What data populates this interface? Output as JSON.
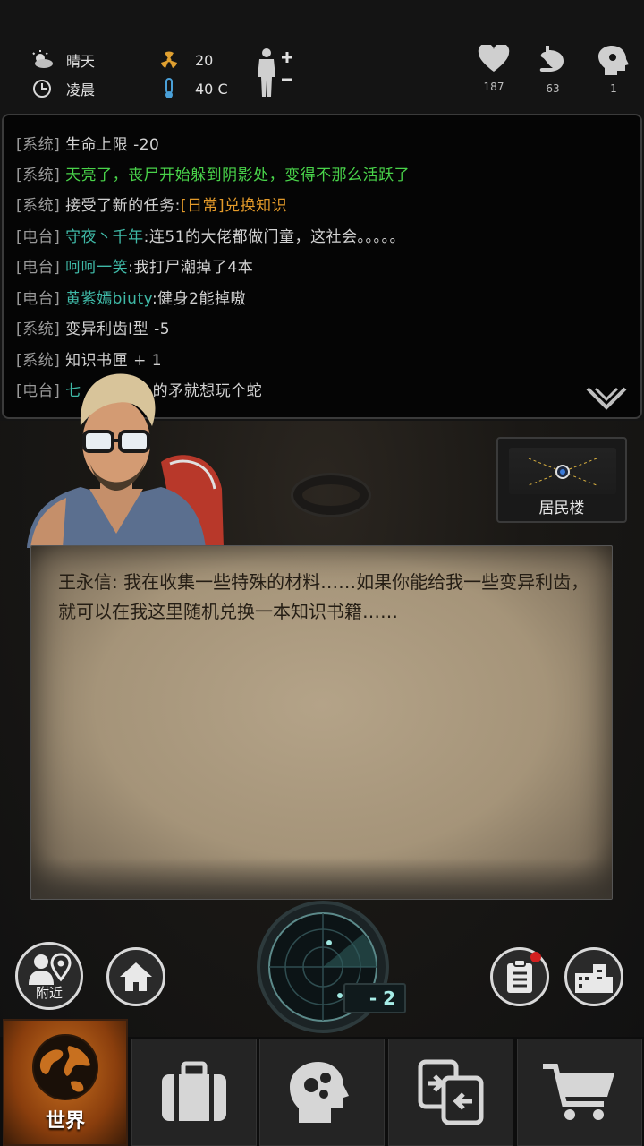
{
  "status": {
    "weather": "晴天",
    "time_of_day": "凌晨",
    "radiation": "20",
    "temperature": "40 C",
    "vitals": [
      {
        "name": "health",
        "icon": "heart-icon",
        "value": "187"
      },
      {
        "name": "hunger",
        "icon": "stomach-icon",
        "value": "63"
      },
      {
        "name": "mind",
        "icon": "head-icon",
        "value": "1"
      }
    ]
  },
  "log": [
    {
      "tag": "[系统]",
      "parts": [
        {
          "text": "生命上限 -20",
          "color": "default"
        }
      ]
    },
    {
      "tag": "[系统]",
      "parts": [
        {
          "text": "天亮了，丧尸开始躲到阴影处，变得不那么活跃了",
          "color": "green"
        }
      ]
    },
    {
      "tag": "[系统]",
      "parts": [
        {
          "text": "接受了新的任务:",
          "color": "default"
        },
        {
          "text": "[日常]兑换知识",
          "color": "orange"
        }
      ]
    },
    {
      "tag": "[电台]",
      "parts": [
        {
          "text": "守夜丶千年",
          "color": "teal"
        },
        {
          "text": ":连51的大佬都做门童，这社会。。。。。",
          "color": "default"
        }
      ]
    },
    {
      "tag": "[电台]",
      "parts": [
        {
          "text": "呵呵一笑",
          "color": "teal"
        },
        {
          "text": ":我打尸潮掉了4本",
          "color": "default"
        }
      ]
    },
    {
      "tag": "[电台]",
      "parts": [
        {
          "text": "黄紫嫣biuty",
          "color": "teal"
        },
        {
          "text": ":健身2能掉嗷",
          "color": "default"
        }
      ]
    },
    {
      "tag": "[系统]",
      "parts": [
        {
          "text": "变异利齿Ⅰ型 -5",
          "color": "default"
        }
      ]
    },
    {
      "tag": "[系统]",
      "parts": [
        {
          "text": "知识书匣 + 1",
          "color": "default"
        }
      ]
    },
    {
      "tag": "[电台]",
      "parts": [
        {
          "text": "七",
          "color": "teal"
        },
        {
          "text": "的矛就想玩个蛇",
          "color": "default"
        }
      ]
    }
  ],
  "location": {
    "label": "居民楼"
  },
  "dialog": {
    "text": "王永信: 我在收集一些特殊的材料……如果你能给我一些变异利齿，就可以在我这里随机兑换一本知识书籍……"
  },
  "controls": {
    "nearby_label": "附近",
    "radar_count": "- 2"
  },
  "tabs": [
    {
      "label": "世界",
      "icon": "globe-icon",
      "active": true
    },
    {
      "label": "",
      "icon": "suitcase-icon",
      "active": false
    },
    {
      "label": "",
      "icon": "brain-head-icon",
      "active": false
    },
    {
      "label": "",
      "icon": "exchange-icon",
      "active": false
    },
    {
      "label": "",
      "icon": "cart-icon",
      "active": false
    }
  ],
  "colors": {
    "green": "#49d34a",
    "orange": "#e39a2a",
    "teal": "#3fb9a7",
    "default": "#d2d2d2",
    "active_tab": "#c8701f"
  }
}
